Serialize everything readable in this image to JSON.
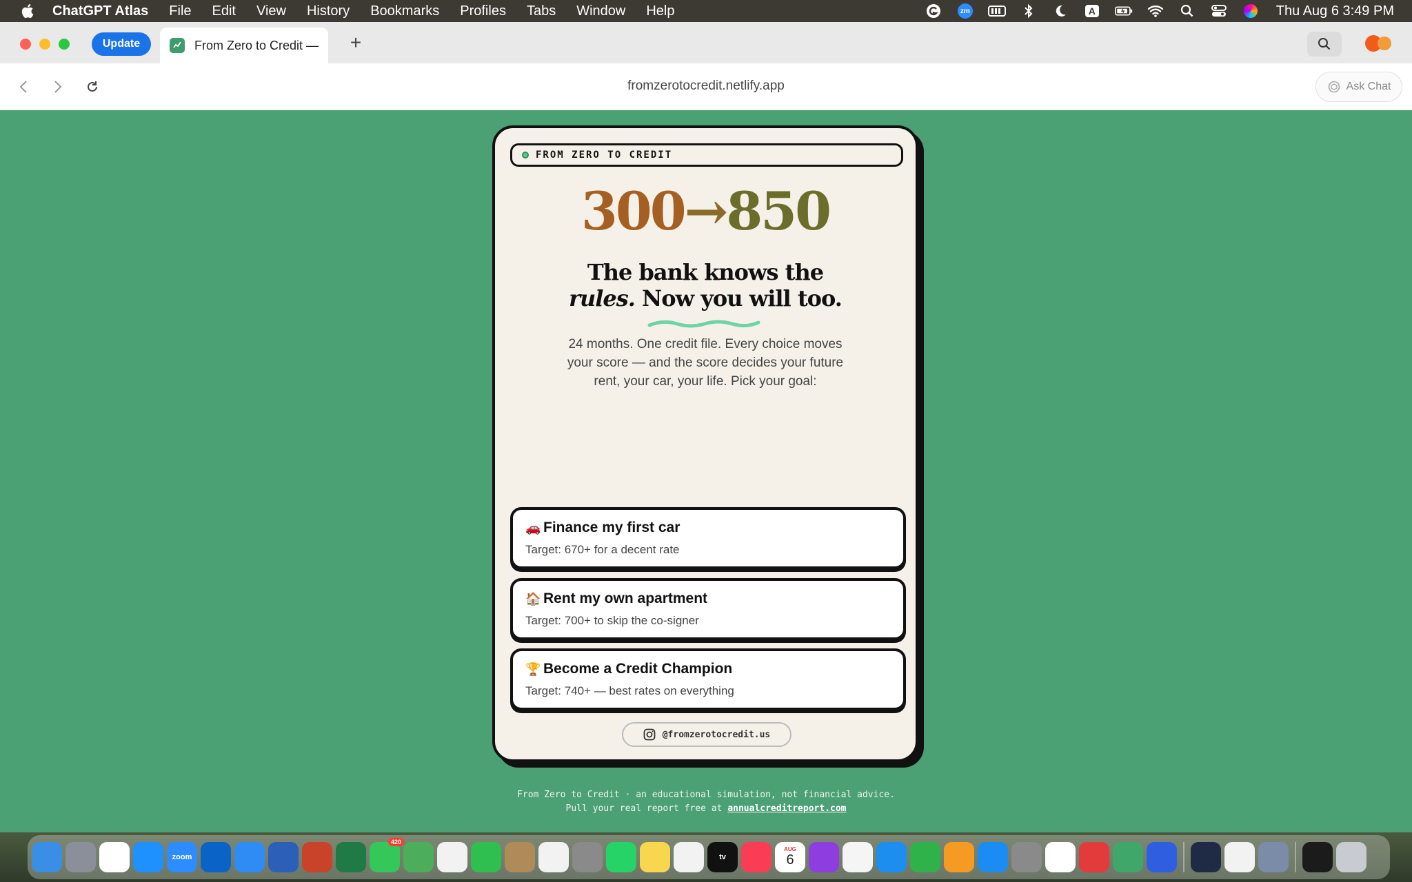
{
  "menubar": {
    "app_name": "ChatGPT Atlas",
    "menus": [
      "File",
      "Edit",
      "View",
      "History",
      "Bookmarks",
      "Profiles",
      "Tabs",
      "Window",
      "Help"
    ],
    "clock": "Thu Aug 6  3:49 PM",
    "status_icons": [
      "grammarly-icon",
      "zoom-icon",
      "battery-app-icon",
      "bluetooth-icon",
      "moon-icon",
      "input-source-icon",
      "battery-icon",
      "wifi-icon",
      "spotlight-icon",
      "control-center-icon",
      "siri-icon"
    ],
    "input_source_label": "A",
    "zoom_label": "zm"
  },
  "browser": {
    "update_label": "Update",
    "tab_title": "From Zero to Credit —",
    "new_tab_label": "+",
    "url": "fromzerotocredit.netlify.app",
    "ask_chat_label": "Ask Chat"
  },
  "page": {
    "pill_label": "FROM ZERO TO CREDIT",
    "score_from": "300",
    "score_arrow": "→",
    "score_to": "850",
    "headline_line1": "The bank knows the",
    "headline_em": "rules.",
    "headline_line2_rest": " Now you will too.",
    "intro": "24 months. One credit file. Every choice moves your score — and the score decides your future rent, your car, your life. Pick your goal:",
    "goals": [
      {
        "emoji": "🚗",
        "title": "Finance my first car",
        "subtitle": "Target: 670+ for a decent rate"
      },
      {
        "emoji": "🏠",
        "title": "Rent my own apartment",
        "subtitle": "Target: 700+ to skip the co-signer"
      },
      {
        "emoji": "🏆",
        "title": "Become a Credit Champion",
        "subtitle": "Target: 740+ — best rates on everything"
      }
    ],
    "social_handle": "@fromzerotocredit.us",
    "footer_line1": "From Zero to Credit · an educational simulation, not financial advice.",
    "footer_line2_prefix": "Pull your real report free at ",
    "footer_link": "annualcreditreport.com"
  },
  "colors": {
    "page_bg": "#4ba173",
    "card_bg": "#f5f1e9",
    "score_from": "#a65f22",
    "score_to": "#6b6d2a",
    "squiggle": "#6fd3a6"
  },
  "dock": {
    "apps": [
      "finder",
      "launchpad",
      "chrome",
      "safari",
      "zoom",
      "outlook",
      "mail",
      "word",
      "powerpoint",
      "excel",
      "messages",
      "maps",
      "photos",
      "facetime",
      "contacts",
      "reminders",
      "iphone-mirroring",
      "whatsapp",
      "notes",
      "freeform",
      "apple-tv",
      "music",
      "calendar",
      "podcasts",
      "news",
      "keynote",
      "numbers",
      "pages",
      "app-store",
      "system-settings",
      "webex",
      "toolbox",
      "cleanmaster",
      "readdle",
      "telegram",
      "drive",
      "preview",
      "terminal",
      "trash"
    ],
    "messages_badge": "420",
    "calendar_month": "AUG",
    "calendar_day": "6",
    "zoom_label": "zoom",
    "tv_label": "tv"
  }
}
